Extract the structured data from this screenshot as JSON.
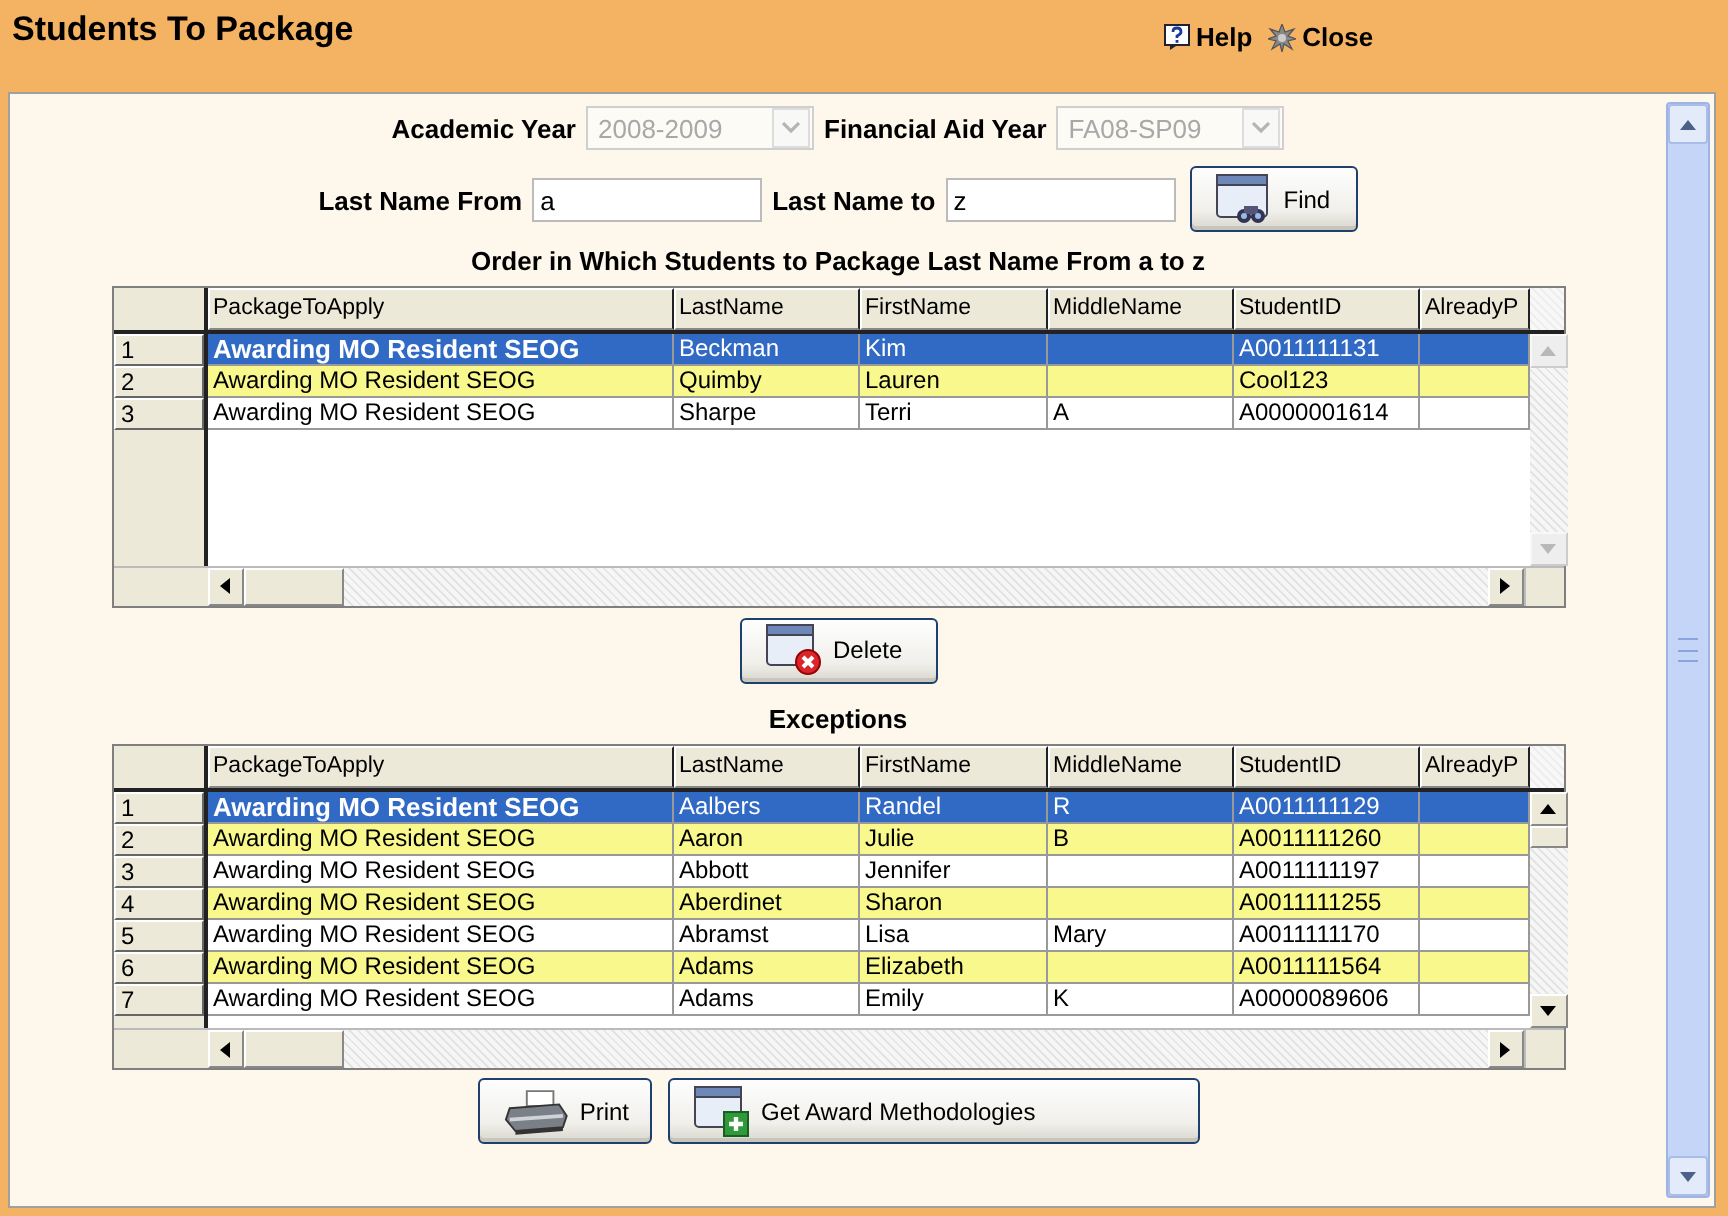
{
  "window": {
    "title": "Students To Package"
  },
  "toolbar": [
    {
      "label": "Help",
      "kind": "help"
    },
    {
      "label": "Close",
      "kind": "close"
    }
  ],
  "filters": {
    "academic_year": {
      "label": "Academic Year",
      "value": "2008-2009",
      "disabled": true
    },
    "financial_aid_year": {
      "label": "Financial Aid Year",
      "value": "FA08-SP09",
      "disabled": true
    },
    "last_name_from": {
      "label": "Last Name From",
      "value": "a"
    },
    "last_name_to": {
      "label": "Last Name to",
      "value": "z"
    },
    "find_button": "Find"
  },
  "order_grid": {
    "caption": "Order in Which Students to Package Last Name From a to z",
    "vertical_scroll_enabled": false,
    "columns": [
      "PackageToApply",
      "LastName",
      "FirstName",
      "MiddleName",
      "StudentID",
      "AlreadyP"
    ],
    "rows": [
      {
        "number": "1",
        "selected": true,
        "package": "Awarding MO Resident SEOG",
        "last_name": "Beckman",
        "first_name": "Kim",
        "student_id": "A0011111131"
      },
      {
        "number": "2",
        "selected": false,
        "package": "Awarding MO Resident SEOG",
        "last_name": "Quimby",
        "first_name": "Lauren",
        "student_id": "Cool123"
      },
      {
        "number": "3",
        "selected": false,
        "package": "Awarding MO Resident SEOG",
        "last_name": "Sharpe",
        "first_name": "Terri",
        "middle_name": "A",
        "student_id": "A0000001614"
      }
    ]
  },
  "delete_button": "Delete",
  "exceptions_grid": {
    "caption": "Exceptions",
    "vertical_scroll_enabled": true,
    "columns": [
      "PackageToApply",
      "LastName",
      "FirstName",
      "MiddleName",
      "StudentID",
      "AlreadyP"
    ],
    "rows": [
      {
        "number": "1",
        "selected": true,
        "package": "Awarding MO Resident SEOG",
        "last_name": "Aalbers",
        "first_name": "Randel",
        "middle_name": "R",
        "student_id": "A0011111129"
      },
      {
        "number": "2",
        "selected": false,
        "package": "Awarding MO Resident SEOG",
        "last_name": "Aaron",
        "first_name": "Julie",
        "middle_name": "B",
        "student_id": "A0011111260"
      },
      {
        "number": "3",
        "selected": false,
        "package": "Awarding MO Resident SEOG",
        "last_name": "Abbott",
        "first_name": "Jennifer",
        "student_id": "A0011111197"
      },
      {
        "number": "4",
        "selected": false,
        "package": "Awarding MO Resident SEOG",
        "last_name": "Aberdinet",
        "first_name": "Sharon",
        "student_id": "A0011111255"
      },
      {
        "number": "5",
        "selected": false,
        "package": "Awarding MO Resident SEOG",
        "last_name": "Abramst",
        "first_name": "Lisa",
        "middle_name": "Mary",
        "student_id": "A0011111170"
      },
      {
        "number": "6",
        "selected": false,
        "package": "Awarding MO Resident SEOG",
        "last_name": "Adams",
        "first_name": "Elizabeth",
        "student_id": "A0011111564"
      },
      {
        "number": "7",
        "selected": false,
        "package": "Awarding MO Resident SEOG",
        "last_name": "Adams",
        "first_name": "Emily",
        "middle_name": "K",
        "student_id": "A0000089606"
      }
    ]
  },
  "buttons": [
    {
      "label": "Print",
      "kind": "print"
    },
    {
      "label": "Get Award Methodologies",
      "kind": "award"
    }
  ]
}
